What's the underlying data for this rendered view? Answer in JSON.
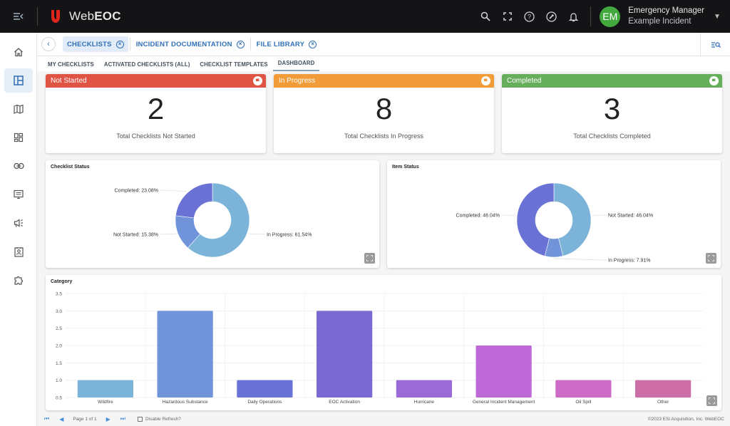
{
  "app": {
    "name_prefix": "Web",
    "name_bold": "EOC"
  },
  "user": {
    "initials": "EM",
    "name": "Emergency Manager",
    "incident": "Example Incident"
  },
  "colors": {
    "brand_red": "#e1251b",
    "accent_blue": "#2f6fb8",
    "avatar_green": "#43a93f",
    "not_started": "#e05444",
    "in_progress": "#f19c38",
    "completed": "#66ad5c"
  },
  "topbar_icons": [
    "search-icon",
    "fullscreen-icon",
    "help-icon",
    "tools-icon",
    "bell-icon"
  ],
  "sidebar": {
    "items": [
      {
        "name": "home",
        "icon": "home-icon",
        "active": false
      },
      {
        "name": "boards",
        "icon": "dashboard-layout-icon",
        "active": true
      },
      {
        "name": "maps",
        "icon": "map-icon",
        "active": false
      },
      {
        "name": "widgets",
        "icon": "widgets-icon",
        "active": false
      },
      {
        "name": "links",
        "icon": "link-icon",
        "active": false
      },
      {
        "name": "display",
        "icon": "display-icon",
        "active": false
      },
      {
        "name": "announcements",
        "icon": "megaphone-icon",
        "active": false
      },
      {
        "name": "contacts",
        "icon": "contact-card-icon",
        "active": false
      },
      {
        "name": "plugins",
        "icon": "puzzle-icon",
        "active": false
      }
    ]
  },
  "tabs": [
    {
      "label": "CHECKLISTS",
      "active": true
    },
    {
      "label": "INCIDENT DOCUMENTATION",
      "active": false
    },
    {
      "label": "FILE LIBRARY",
      "active": false
    }
  ],
  "subtabs": [
    {
      "label": "MY CHECKLISTS",
      "active": false
    },
    {
      "label": "ACTIVATED CHECKLISTS (ALL)",
      "active": false
    },
    {
      "label": "CHECKLIST TEMPLATES",
      "active": false
    },
    {
      "label": "DASHBOARD",
      "active": true
    }
  ],
  "cards": [
    {
      "title": "Not Started",
      "value": "2",
      "label": "Total Checklists Not Started",
      "color": "#e05444"
    },
    {
      "title": "In Progress",
      "value": "8",
      "label": "Total Checklists In Progress",
      "color": "#f19c38"
    },
    {
      "title": "Completed",
      "value": "3",
      "label": "Total Checklists Completed",
      "color": "#66ad5c"
    }
  ],
  "chart_data": [
    {
      "type": "pie",
      "title": "Checklist Status",
      "donut": true,
      "slices": [
        {
          "label": "In Progress",
          "value": 61.54,
          "display": "In Progress: 61.54%",
          "color": "#7bb4d8"
        },
        {
          "label": "Not Started",
          "value": 15.38,
          "display": "Not Started: 15.38%",
          "color": "#7193d9"
        },
        {
          "label": "Completed",
          "value": 23.08,
          "display": "Completed: 23.08%",
          "color": "#6b72d5"
        }
      ]
    },
    {
      "type": "pie",
      "title": "Item Status",
      "donut": true,
      "slices": [
        {
          "label": "Not Started",
          "value": 46.04,
          "display": "Not Started: 46.04%",
          "color": "#7bb4d8"
        },
        {
          "label": "In Progress",
          "value": 7.91,
          "display": "In Progress: 7.91%",
          "color": "#7193d9"
        },
        {
          "label": "Completed",
          "value": 46.04,
          "display": "Completed: 46.04%",
          "color": "#6b72d5"
        }
      ]
    },
    {
      "type": "bar",
      "title": "Category",
      "categories": [
        "Wildfire",
        "Hazardous Substance",
        "Daily Operations",
        "EOC Activation",
        "Hurricane",
        "General Incident Management",
        "Oil Spill",
        "Other"
      ],
      "values": [
        1,
        3,
        1,
        3,
        1,
        2,
        1,
        1
      ],
      "colors": [
        "#7bb4d8",
        "#7193d9",
        "#6b72d5",
        "#7a69d2",
        "#9b6ad6",
        "#bd69d8",
        "#cd6bc6",
        "#cd6da6"
      ],
      "ylim": [
        0.5,
        3.5
      ],
      "yticks": [
        "0.5",
        "1.0",
        "1.5",
        "2.0",
        "2.5",
        "3.0",
        "3.5"
      ],
      "xlabel": "",
      "ylabel": "",
      "grid": true
    }
  ],
  "footer": {
    "page": "Page 1 of 1",
    "refresh_label": "Disable Refresh?",
    "copyright": "©2023 ESi Acquisition, Inc. WebEOC"
  }
}
